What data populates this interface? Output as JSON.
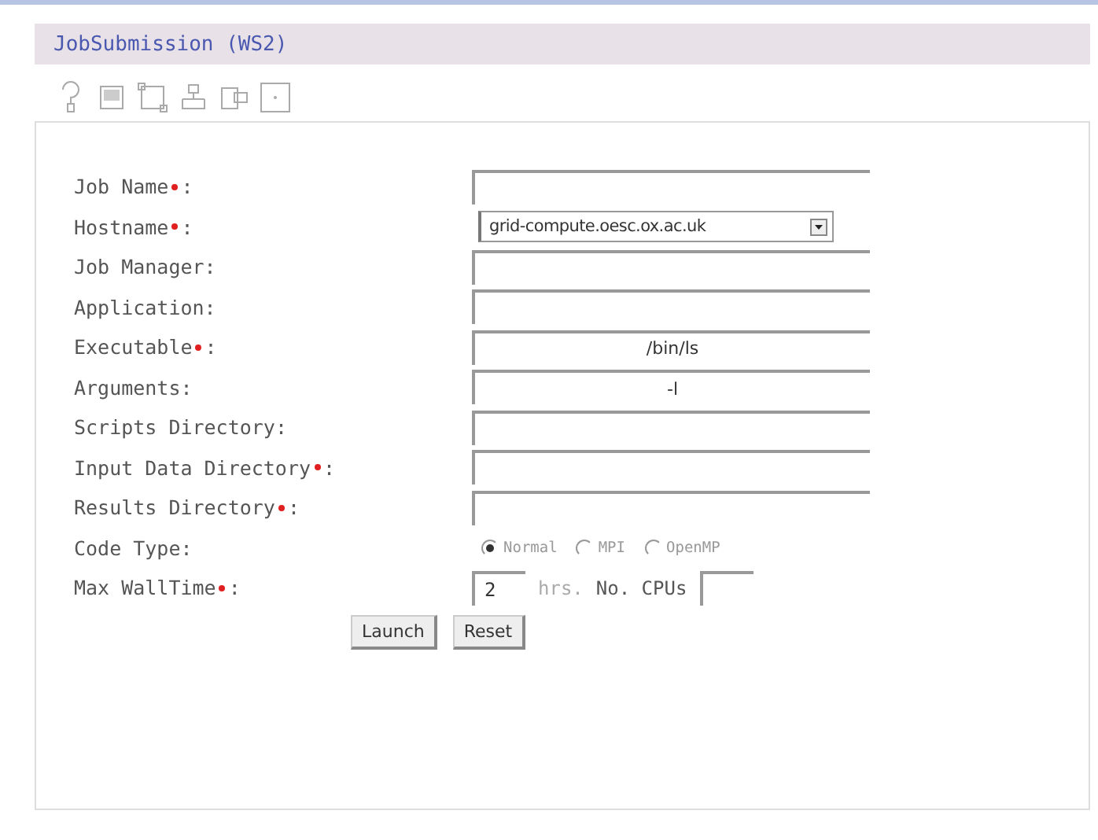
{
  "window": {
    "title": "JobSubmission (WS2)"
  },
  "fields": [
    {
      "kind": "text",
      "label": "Job Name",
      "required": true,
      "colon": ":"
    },
    {
      "kind": "select",
      "label": "Hostname",
      "required": true,
      "colon": ":",
      "value": "grid-compute.oesc.ox.ac.uk"
    },
    {
      "kind": "text",
      "label": "Job Manager",
      "required": false,
      "colon": ":"
    },
    {
      "kind": "text",
      "label": "Application",
      "required": false,
      "colon": ":"
    },
    {
      "kind": "text",
      "label": "Executable",
      "required": true,
      "colon": ":",
      "value": "/bin/ls"
    },
    {
      "kind": "text",
      "label": "Arguments",
      "required": false,
      "colon": ":",
      "value": "-l"
    },
    {
      "kind": "text",
      "label": "Scripts Directory",
      "required": false,
      "colon": ":"
    },
    {
      "kind": "text",
      "label": "Input Data Directory",
      "required": true,
      "colon": ":"
    },
    {
      "kind": "text",
      "label": "Results Directory",
      "required": true,
      "colon": ":"
    },
    {
      "kind": "radio",
      "label": "Code Type",
      "required": false,
      "colon": ":",
      "options": [
        {
          "label": "Normal",
          "selected": true
        },
        {
          "label": "MPI",
          "selected": false
        },
        {
          "label": "OpenMP",
          "selected": false
        }
      ]
    },
    {
      "kind": "walltime",
      "label": "Max WallTime",
      "required": true,
      "colon": ":",
      "value": "2",
      "unit": "hrs.",
      "cpus_label": "No. CPUs"
    }
  ],
  "buttons": [
    "Launch",
    "Reset"
  ]
}
